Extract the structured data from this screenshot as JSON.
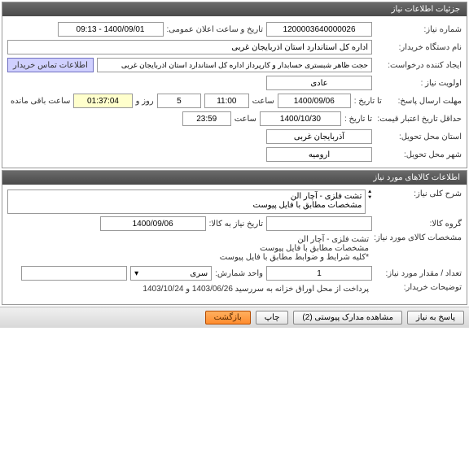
{
  "panel1": {
    "title": "جزئیات اطلاعات نیاز",
    "needNo_label": "شماره نیاز:",
    "needNo": "1200003640000026",
    "announceDateTime_label": "تاریخ و ساعت اعلان عمومی:",
    "announceDateTime": "1400/09/01 - 09:13",
    "buyerOrg_label": "نام دستگاه خریدار:",
    "buyerOrg": "اداره کل استاندارد استان اذربایجان غربی",
    "creator_label": "ایجاد کننده درخواست:",
    "creator": "حجت ظاهر شبستری حسابدار و کارپرداز اداره کل استاندارد استان اذربایجان غربی",
    "buyerContact_btn": "اطلاعات تماس خریدار",
    "priority_label": "اولویت نیاز :",
    "priority": "عادی",
    "answerDeadline_label": "مهلت ارسال پاسخ:",
    "toDate_label": "تا تاریخ :",
    "answerDate": "1400/09/06",
    "time_label": "ساعت",
    "answerTime": "11:00",
    "daysRemain": "5",
    "days_label": "روز و",
    "countdown": "01:37:04",
    "remain_label": "ساعت باقی مانده",
    "minValidity_label": "حداقل تاریخ اعتبار قیمت:",
    "validityDate": "1400/10/30",
    "validityTime": "23:59",
    "deliveryProvince_label": "استان محل تحویل:",
    "deliveryProvince": "آذربایجان غربی",
    "deliveryCity_label": "شهر محل تحویل:",
    "deliveryCity": "ارومیه"
  },
  "panel2": {
    "title": "اطلاعات کالاهای مورد نیاز",
    "generalDesc_label": "شرح کلی نیاز:",
    "generalDesc": "تشت فلزی - آچار الن\nمشخصات مطابق با فایل پیوست",
    "itemArrows": "⯅\n⯆",
    "group_label": "گروه کالا:",
    "group": "",
    "needToDate_label": "تاریخ نیاز به کالا:",
    "needToDate": "1400/09/06",
    "itemSpec_label": "مشخصات کالای مورد نیاز:",
    "itemSpec": "تشت فلزی - آچار الن\nمشخصات مطابق با فایل پیوست\n*کلیه شرایط و ضوابط مطابق با فایل پیوست",
    "qty_label": "تعداد / مقدار مورد نیاز:",
    "qty": "1",
    "unit_label": "واحد شمارش:",
    "unit": "سری",
    "unitArrow": "▾",
    "buyerNotes_label": "توضیحات خریدار:",
    "buyerNotes": "پرداخت از محل اوراق خزانه به سررسید 1403/06/26 و 1403/10/24"
  },
  "buttons": {
    "respond": "پاسخ به نیاز",
    "attachments": "مشاهده مدارک پیوستی (2)",
    "print": "چاپ",
    "back": "بازگشت"
  }
}
